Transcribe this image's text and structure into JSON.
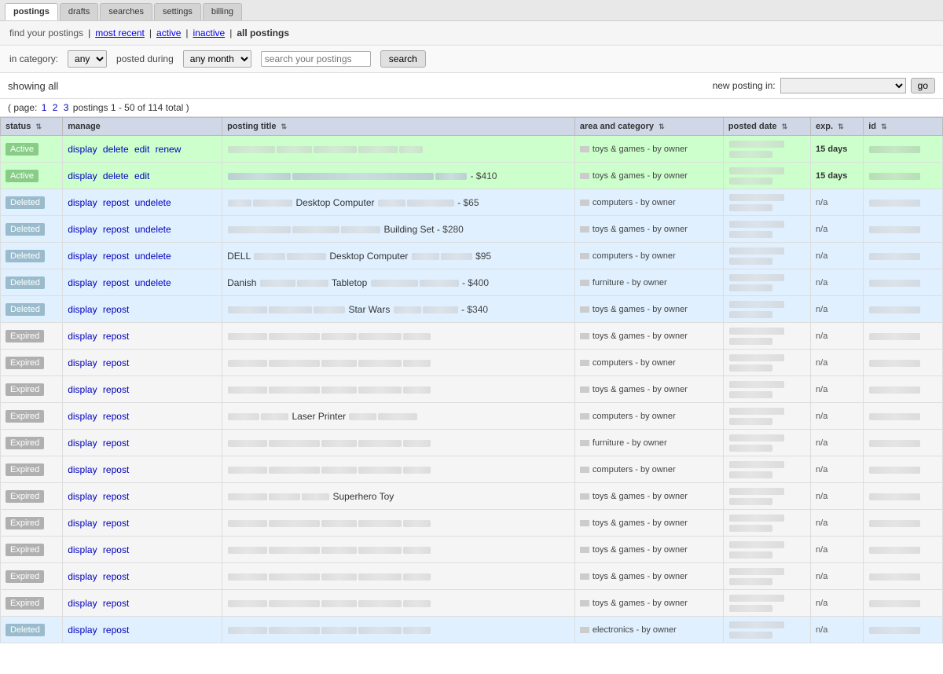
{
  "nav": {
    "tabs": [
      {
        "label": "postings",
        "active": true
      },
      {
        "label": "drafts",
        "active": false
      },
      {
        "label": "searches",
        "active": false
      },
      {
        "label": "settings",
        "active": false
      },
      {
        "label": "billing",
        "active": false
      }
    ]
  },
  "filter": {
    "find_label": "find your postings",
    "links": [
      {
        "label": "most recent",
        "href": "#"
      },
      {
        "label": "active",
        "href": "#"
      },
      {
        "label": "inactive",
        "href": "#"
      },
      {
        "label": "all postings",
        "bold": true
      }
    ],
    "category_label": "in category:",
    "category_value": "any",
    "posted_during_label": "posted during",
    "posted_during_value": "any month",
    "search_placeholder": "search your postings",
    "search_btn": "search"
  },
  "showing": {
    "text": "showing all",
    "new_posting_label": "new posting in:",
    "go_btn": "go"
  },
  "pagination": {
    "prefix": "( page:",
    "current": "1",
    "pages": [
      "1",
      "2",
      "3"
    ],
    "postings_info": "postings 1 - 50 of 114 total )"
  },
  "table": {
    "headers": [
      {
        "label": "status",
        "sortable": true
      },
      {
        "label": "manage",
        "sortable": false
      },
      {
        "label": "posting title",
        "sortable": true
      },
      {
        "label": "area and category",
        "sortable": true
      },
      {
        "label": "posted date",
        "sortable": true
      },
      {
        "label": "exp.",
        "sortable": true
      },
      {
        "label": "id",
        "sortable": true
      }
    ],
    "rows": [
      {
        "status": "Active",
        "row_class": "row-active",
        "manage": [
          "display",
          "delete",
          "edit",
          "renew"
        ],
        "title": "blurred_long",
        "area": "toys & games - by owner",
        "date": "blurred",
        "exp": "15 days",
        "id_type": "green"
      },
      {
        "status": "Active",
        "row_class": "row-active",
        "manage": [
          "display",
          "delete",
          "edit"
        ],
        "title": "blurred_price_410",
        "area": "toys & games - by owner",
        "date": "blurred",
        "exp": "15 days",
        "id_type": "green"
      },
      {
        "status": "Deleted",
        "row_class": "row-deleted",
        "manage": [
          "display",
          "repost",
          "undelete"
        ],
        "title": "desktop_computer_65",
        "area": "computers - by owner",
        "date": "blurred",
        "exp": "n/a",
        "id_type": "gray"
      },
      {
        "status": "Deleted",
        "row_class": "row-deleted",
        "manage": [
          "display",
          "repost",
          "undelete"
        ],
        "title": "building_set_280",
        "area": "toys & games - by owner",
        "date": "blurred",
        "exp": "n/a",
        "id_type": "gray"
      },
      {
        "status": "Deleted",
        "row_class": "row-deleted",
        "manage": [
          "display",
          "repost",
          "undelete"
        ],
        "title": "dell_desktop_95",
        "area": "computers - by owner",
        "date": "blurred",
        "exp": "n/a",
        "id_type": "gray"
      },
      {
        "status": "Deleted",
        "row_class": "row-deleted",
        "manage": [
          "display",
          "repost",
          "undelete"
        ],
        "title": "danish_tabletop_400",
        "area": "furniture - by owner",
        "date": "blurred",
        "exp": "n/a",
        "id_type": "gray"
      },
      {
        "status": "Deleted",
        "row_class": "row-deleted",
        "manage": [
          "display",
          "repost"
        ],
        "title": "star_wars_340",
        "area": "toys & games - by owner",
        "date": "blurred",
        "exp": "n/a",
        "id_type": "gray"
      },
      {
        "status": "Expired",
        "row_class": "row-expired",
        "manage": [
          "display",
          "repost"
        ],
        "title": "blurred_only",
        "area": "toys & games - by owner",
        "date": "blurred",
        "exp": "n/a",
        "id_type": "gray"
      },
      {
        "status": "Expired",
        "row_class": "row-expired",
        "manage": [
          "display",
          "repost"
        ],
        "title": "blurred_only",
        "area": "computers - by owner",
        "date": "blurred",
        "exp": "n/a",
        "id_type": "gray"
      },
      {
        "status": "Expired",
        "row_class": "row-expired",
        "manage": [
          "display",
          "repost"
        ],
        "title": "blurred_only",
        "area": "toys & games - by owner",
        "date": "blurred",
        "exp": "n/a",
        "id_type": "gray"
      },
      {
        "status": "Expired",
        "row_class": "row-expired",
        "manage": [
          "display",
          "repost"
        ],
        "title": "laser_printer",
        "area": "computers - by owner",
        "date": "blurred",
        "exp": "n/a",
        "id_type": "gray"
      },
      {
        "status": "Expired",
        "row_class": "row-expired",
        "manage": [
          "display",
          "repost"
        ],
        "title": "blurred_only",
        "area": "furniture - by owner",
        "date": "blurred",
        "exp": "n/a",
        "id_type": "gray"
      },
      {
        "status": "Expired",
        "row_class": "row-expired",
        "manage": [
          "display",
          "repost"
        ],
        "title": "blurred_only",
        "area": "computers - by owner",
        "date": "blurred",
        "exp": "n/a",
        "id_type": "gray"
      },
      {
        "status": "Expired",
        "row_class": "row-expired",
        "manage": [
          "display",
          "repost"
        ],
        "title": "superhero_toy",
        "area": "toys & games - by owner",
        "date": "blurred",
        "exp": "n/a",
        "id_type": "gray"
      },
      {
        "status": "Expired",
        "row_class": "row-expired",
        "manage": [
          "display",
          "repost"
        ],
        "title": "blurred_only",
        "area": "toys & games - by owner",
        "date": "blurred",
        "exp": "n/a",
        "id_type": "gray"
      },
      {
        "status": "Expired",
        "row_class": "row-expired",
        "manage": [
          "display",
          "repost"
        ],
        "title": "blurred_only",
        "area": "toys & games - by owner",
        "date": "blurred",
        "exp": "n/a",
        "id_type": "gray"
      },
      {
        "status": "Expired",
        "row_class": "row-expired",
        "manage": [
          "display",
          "repost"
        ],
        "title": "blurred_only",
        "area": "toys & games - by owner",
        "date": "blurred",
        "exp": "n/a",
        "id_type": "gray"
      },
      {
        "status": "Expired",
        "row_class": "row-expired",
        "manage": [
          "display",
          "repost"
        ],
        "title": "blurred_only",
        "area": "toys & games - by owner",
        "date": "blurred",
        "exp": "n/a",
        "id_type": "gray"
      },
      {
        "status": "Deleted",
        "row_class": "row-deleted",
        "manage": [
          "display",
          "repost"
        ],
        "title": "blurred_only",
        "area": "electronics - by owner",
        "date": "blurred",
        "exp": "n/a",
        "id_type": "gray"
      }
    ]
  }
}
